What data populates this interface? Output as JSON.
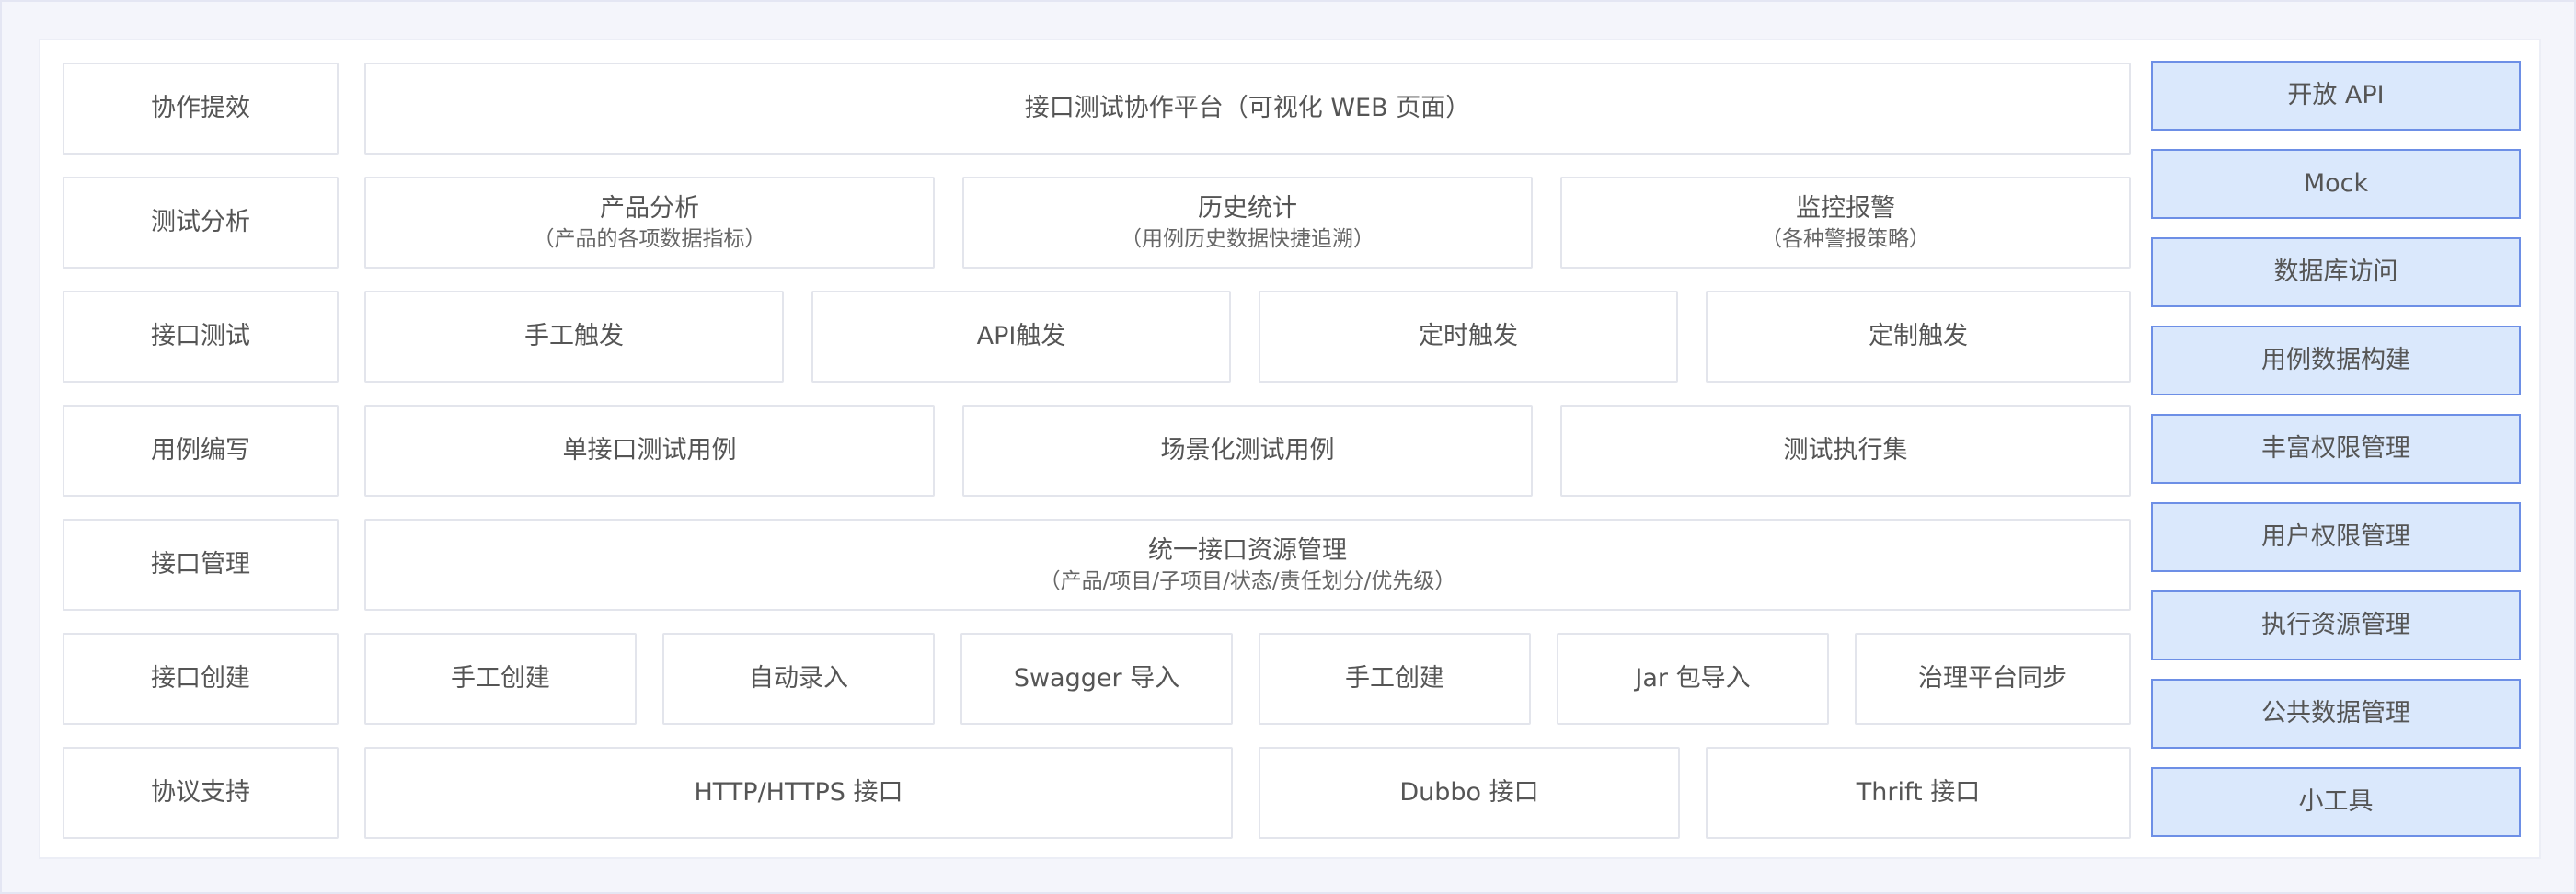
{
  "rows": {
    "r1": {
      "label": "协作提效",
      "boxes": [
        {
          "text": "接口测试协作平台（可视化 WEB 页面）"
        }
      ]
    },
    "r2": {
      "label": "测试分析",
      "boxes": [
        {
          "text": "产品分析",
          "sub": "（产品的各项数据指标）"
        },
        {
          "text": "历史统计",
          "sub": "（用例历史数据快捷追溯）"
        },
        {
          "text": "监控报警",
          "sub": "（各种警报策略）"
        }
      ]
    },
    "r3": {
      "label": "接口测试",
      "boxes": [
        {
          "text": "手工触发"
        },
        {
          "text": "API触发"
        },
        {
          "text": "定时触发"
        },
        {
          "text": "定制触发"
        }
      ]
    },
    "r4": {
      "label": "用例编写",
      "boxes": [
        {
          "text": "单接口测试用例"
        },
        {
          "text": "场景化测试用例"
        },
        {
          "text": "测试执行集"
        }
      ]
    },
    "r5": {
      "label": "接口管理",
      "boxes": [
        {
          "text": "统一接口资源管理",
          "sub": "（产品/项目/子项目/状态/责任划分/优先级）"
        }
      ]
    },
    "r6": {
      "label": "接口创建",
      "boxes": [
        {
          "text": "手工创建"
        },
        {
          "text": "自动录入"
        },
        {
          "text": "Swagger 导入"
        },
        {
          "text": "手工创建"
        },
        {
          "text": "Jar 包导入"
        },
        {
          "text": "治理平台同步"
        }
      ]
    },
    "r7": {
      "label": "协议支持",
      "boxes": [
        {
          "text": "HTTP/HTTPS 接口"
        },
        {
          "text": "Dubbo 接口"
        },
        {
          "text": "Thrift 接口"
        }
      ]
    }
  },
  "side_items": [
    "开放 API",
    "Mock",
    "数据库访问",
    "用例数据构建",
    "丰富权限管理",
    "用户权限管理",
    "执行资源管理",
    "公共数据管理",
    "小工具"
  ],
  "colors": {
    "background": "#f4f5fb",
    "panel": "#ffffff",
    "box_border": "#e3e5ec",
    "side_fill": "#dae8fc",
    "side_border": "#6d8fe6",
    "text": "#555555"
  }
}
